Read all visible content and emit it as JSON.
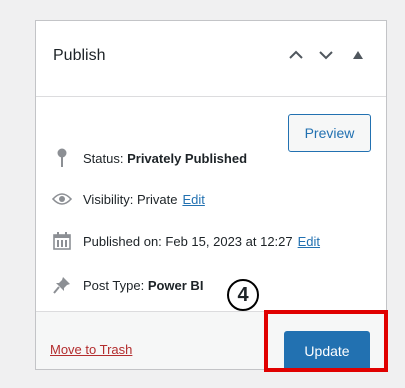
{
  "header": {
    "title": "Publish",
    "icons": [
      "chevron-up-icon",
      "chevron-down-icon",
      "triangle-toggle-icon"
    ]
  },
  "preview_label": "Preview",
  "status": {
    "label": "Status:",
    "value": "Privately Published",
    "icon": "pin-icon"
  },
  "visibility": {
    "label": "Visibility:",
    "value": "Private",
    "edit_label": "Edit",
    "icon": "eye-icon"
  },
  "published": {
    "label": "Published on:",
    "value": "Feb 15, 2023 at 12:27",
    "edit_label": "Edit",
    "icon": "calendar-icon"
  },
  "post_type": {
    "label": "Post Type:",
    "value": "Power BI",
    "icon": "pushpin-icon"
  },
  "footer": {
    "trash_label": "Move to Trash",
    "update_label": "Update"
  },
  "annotation": {
    "step_number": "4",
    "highlight_color": "#e00000"
  },
  "colors": {
    "accent": "#2271b1",
    "trash": "#b32d2e"
  }
}
